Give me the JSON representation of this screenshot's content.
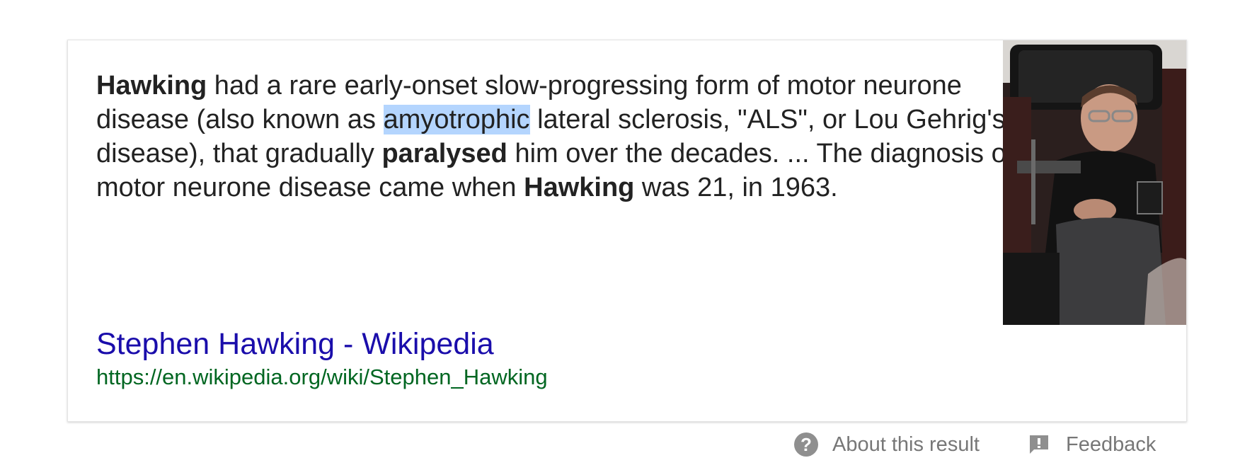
{
  "snippet": {
    "part1_bold": "Hawking",
    "part2": " had a rare early-onset slow-progressing form of motor neurone disease (also known as ",
    "part3_highlight": "amyotrophic",
    "part4": " lateral sclerosis, \"ALS\", or Lou Gehrig's disease), that gradually ",
    "part5_bold": "paralysed",
    "part6": " him over the decades. ... The diagnosis of motor neurone disease came when ",
    "part7_bold": "Hawking",
    "part8": " was 21, in 1963."
  },
  "result": {
    "title": "Stephen Hawking - Wikipedia",
    "url": "https://en.wikipedia.org/wiki/Stephen_Hawking"
  },
  "footer": {
    "about_label": "About this result",
    "feedback_label": "Feedback"
  },
  "colors": {
    "link": "#1a0dab",
    "url": "#006621",
    "highlight": "#b4d5fe",
    "muted": "#777777"
  },
  "icons": {
    "about": "question-circle-icon",
    "feedback": "feedback-flag-icon"
  }
}
